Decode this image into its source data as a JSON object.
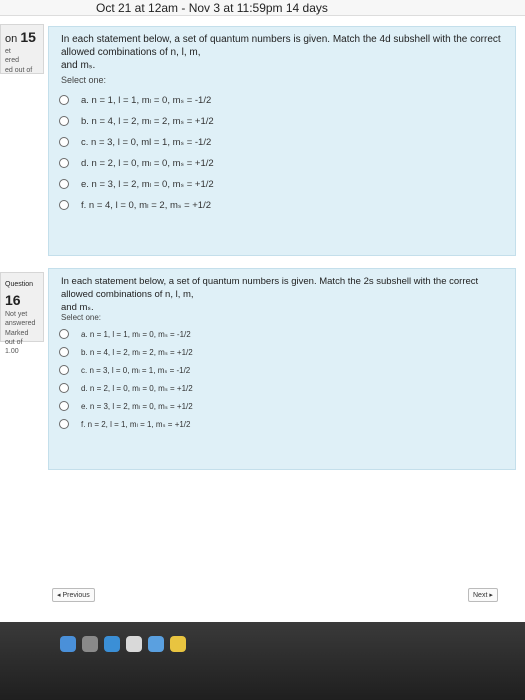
{
  "header": {
    "dates": "Oct 21 at 12am - Nov 3 at 11:59pm 14 days"
  },
  "q15": {
    "side": {
      "num_prefix": "on",
      "num": "15",
      "line1": "et",
      "line2": "ered",
      "line3": "ed out of"
    },
    "text_line1": "In each statement below, a set of quantum numbers is given. Match the 4d subshell with the correct allowed combinations of n, l, m,",
    "text_line2": "and mₛ.",
    "select_one": "Select one:",
    "options": [
      "a. n = 1, l = 1, mₗ = 0, mₛ = -1/2",
      "b. n = 4, l = 2, mₗ = 2, mₛ = +1/2",
      "c. n = 3, l = 0, ml = 1, mₛ = -1/2",
      "d. n = 2, l = 0, mₗ = 0, mₛ = +1/2",
      "e. n = 3, l = 2, mₗ = 0, mₛ = +1/2",
      "f. n = 4, l = 0, mₗ = 2, mₛ = +1/2"
    ]
  },
  "q16": {
    "side": {
      "label": "Question",
      "num": "16",
      "status1": "Not yet",
      "status2": "answered",
      "marked": "Marked out of",
      "points": "1.00"
    },
    "text_line1": "In each statement below, a set of quantum numbers is given. Match the 2s subshell with the correct allowed combinations of n, l, m,",
    "text_line2": "and mₛ.",
    "select_one": "Select one:",
    "options": [
      "a. n = 1, l = 1, mₗ = 0, mₛ = -1/2",
      "b. n = 4, l = 2, mₗ = 2, mₛ = +1/2",
      "c. n = 3, l = 0, mₗ = 1, mₛ = -1/2",
      "d. n = 2, l = 0, mₗ = 0, mₛ = +1/2",
      "e. n = 3, l = 2, mₗ = 0, mₛ = +1/2",
      "f. n = 2, l = 1, mₗ = 1, mₛ = +1/2"
    ]
  },
  "nav": {
    "previous": "◂ Previous",
    "next": "Next ▸"
  }
}
